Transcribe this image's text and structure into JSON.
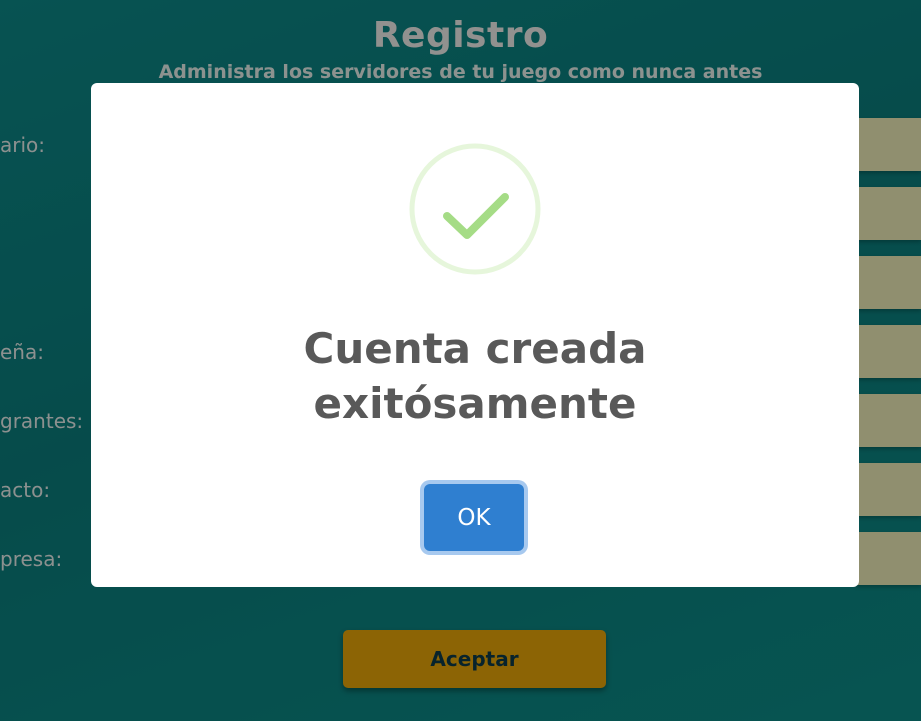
{
  "page": {
    "title": "Registro",
    "subtitle": "Administra los servidores de tu juego como nunca antes",
    "fields": [
      {
        "label": "ario:"
      },
      {
        "label": ""
      },
      {
        "label": ""
      },
      {
        "label": "eña:"
      },
      {
        "label": "grantes:"
      },
      {
        "label": "acto:"
      },
      {
        "label": "presa:"
      }
    ],
    "accept_label": "Aceptar"
  },
  "modal": {
    "icon": "check-icon",
    "title_line1": "Cuenta creada",
    "title_line2": "exitósamente",
    "ok_label": "OK"
  },
  "colors": {
    "background": "#0a7e7d",
    "input_bg": "#f0eeb9",
    "accept_bg": "#e9a709",
    "ok_bg": "#2f7fd0",
    "success_green": "#a5dc86"
  }
}
